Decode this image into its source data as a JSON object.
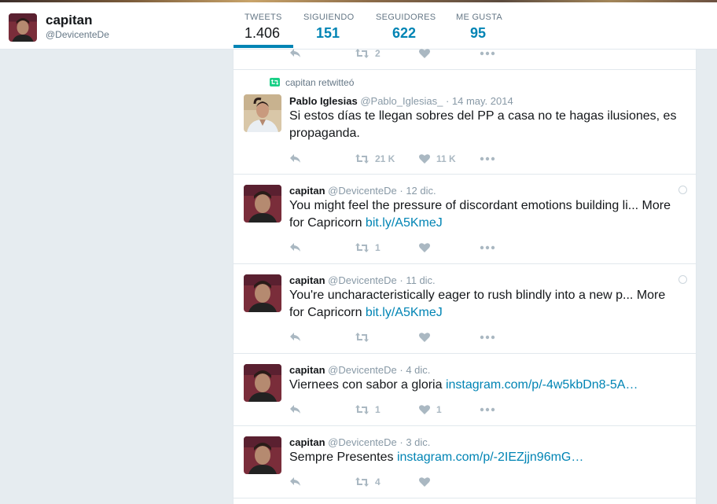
{
  "profile": {
    "name": "capitan",
    "handle": "@DevicenteDe"
  },
  "nav": [
    {
      "label": "TWEETS",
      "value": "1.406"
    },
    {
      "label": "SIGUIENDO",
      "value": "151"
    },
    {
      "label": "SEGUIDORES",
      "value": "622"
    },
    {
      "label": "ME GUSTA",
      "value": "95"
    }
  ],
  "colors": {
    "accent": "#0084b4",
    "retweet": "#19cf86",
    "muted": "#aab8c2",
    "background": "#e6ecf0"
  },
  "icons": {
    "reply": "reply-icon",
    "retweet": "retweet-icon",
    "like": "heart-icon",
    "more": "more-icon",
    "globe": "globe-icon"
  },
  "tweets": [
    {
      "retweet_count": "2",
      "like_count": ""
    },
    {
      "context": "capitan retwitteó",
      "name": "Pablo Iglesias",
      "handle": "@Pablo_Iglesias_",
      "date": "· 14 may. 2014",
      "text": "Si estos días te llegan sobres del PP a casa no te hagas ilusiones, es propaganda.",
      "link": "",
      "retweet_count": "21 K",
      "like_count": "11 K"
    },
    {
      "name": "capitan",
      "handle": "@DevicenteDe",
      "date": "· 12 dic.",
      "text": "You might feel the pressure of discordant emotions building li... More for Capricorn ",
      "link": "bit.ly/A5KmeJ",
      "retweet_count": "1",
      "like_count": ""
    },
    {
      "name": "capitan",
      "handle": "@DevicenteDe",
      "date": "· 11 dic.",
      "text": "You're uncharacteristically eager to rush blindly into a new p... More for Capricorn ",
      "link": "bit.ly/A5KmeJ",
      "retweet_count": "",
      "like_count": ""
    },
    {
      "name": "capitan",
      "handle": "@DevicenteDe",
      "date": "· 4 dic.",
      "text": "Viernees con sabor a gloria ",
      "link": "instagram.com/p/-4w5kbDn8-5A…",
      "retweet_count": "1",
      "like_count": "1"
    },
    {
      "name": "capitan",
      "handle": "@DevicenteDe",
      "date": "· 3 dic.",
      "text": "Sempre Presentes ",
      "link": "instagram.com/p/-2IEZjjn96mG…",
      "retweet_count": "4",
      "like_count": ""
    }
  ]
}
